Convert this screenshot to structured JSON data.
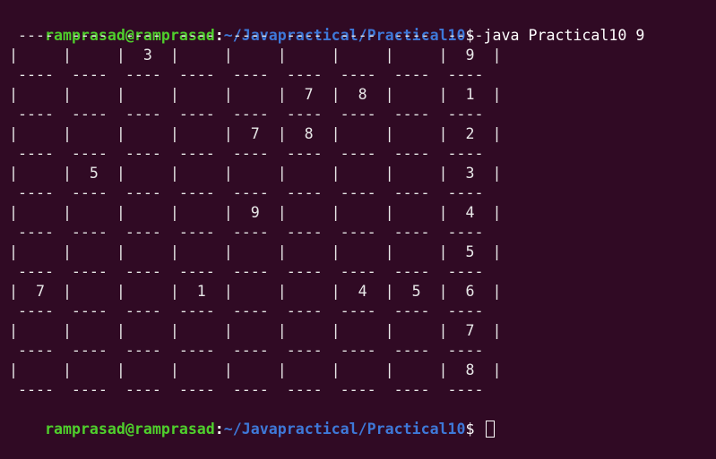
{
  "prompt": {
    "user_host": "ramprasad@ramprasad",
    "separator": ":",
    "path": "~/Javapractical/Practical10",
    "symbol": "$ "
  },
  "command": "java Practical10 9",
  "grid": {
    "border_line": " ----  ----  ----  ----  ----  ----  ----  ----  ----",
    "rows": [
      "|     |     |  3  |     |     |     |     |     |  9  |",
      "|     |     |     |     |     |  7  |  8  |     |  1  |",
      "|     |     |     |     |  7  |  8  |     |     |  2  |",
      "|     |  5  |     |     |     |     |     |     |  3  |",
      "|     |     |     |     |  9  |     |     |     |  4  |",
      "|     |     |     |     |     |     |     |     |  5  |",
      "|  7  |     |     |  1  |     |     |  4  |  5  |  6  |",
      "|     |     |     |     |     |     |     |     |  7  |",
      "|     |     |     |     |     |     |     |     |  8  |"
    ]
  }
}
